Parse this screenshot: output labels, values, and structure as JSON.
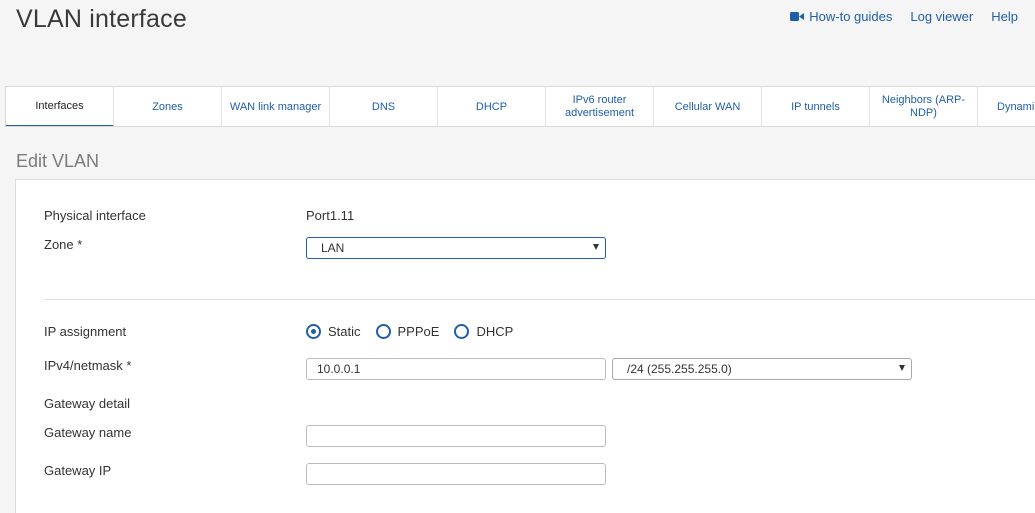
{
  "header": {
    "title": "VLAN interface",
    "links": [
      {
        "label": "How-to guides",
        "icon": "video-camera-icon"
      },
      {
        "label": "Log viewer"
      },
      {
        "label": "Help"
      }
    ]
  },
  "tabs": [
    {
      "label": "Interfaces",
      "active": true
    },
    {
      "label": "Zones"
    },
    {
      "label": "WAN link manager"
    },
    {
      "label": "DNS"
    },
    {
      "label": "DHCP"
    },
    {
      "label": "IPv6 router advertisement"
    },
    {
      "label": "Cellular WAN"
    },
    {
      "label": "IP tunnels"
    },
    {
      "label": "Neighbors (ARP-NDP)"
    },
    {
      "label": "Dynami"
    }
  ],
  "section": {
    "title": "Edit VLAN"
  },
  "form": {
    "physical_interface": {
      "label": "Physical interface",
      "value": "Port1.11"
    },
    "zone": {
      "label": "Zone *",
      "value": "LAN"
    },
    "ip_assignment": {
      "label": "IP assignment",
      "options": [
        {
          "label": "Static",
          "checked": true
        },
        {
          "label": "PPPoE"
        },
        {
          "label": "DHCP"
        }
      ]
    },
    "ipv4": {
      "label": "IPv4/netmask *",
      "value": "10.0.0.1",
      "netmask": "/24 (255.255.255.0)"
    },
    "gateway_detail": {
      "label": "Gateway detail"
    },
    "gateway_name": {
      "label": "Gateway name",
      "value": ""
    },
    "gateway_ip": {
      "label": "Gateway IP",
      "value": ""
    }
  },
  "colors": {
    "accent": "#1f5fa8",
    "background": "#f5f5f5",
    "panel": "#ffffff"
  }
}
